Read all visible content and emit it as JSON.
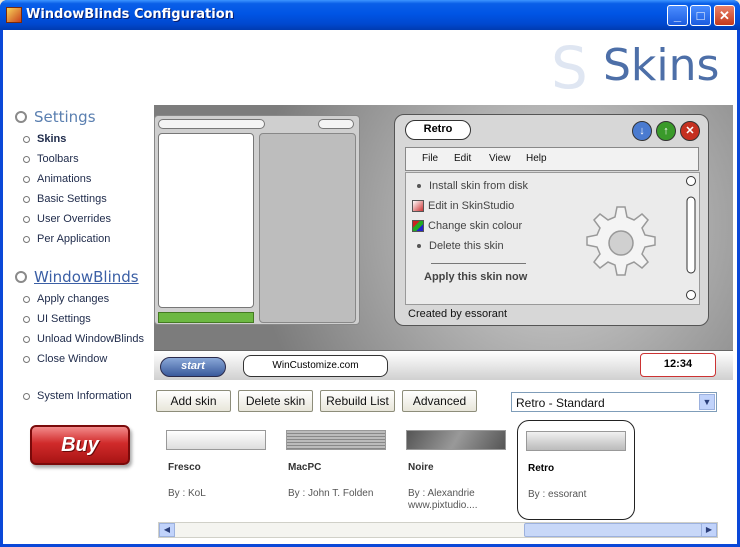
{
  "window": {
    "title": "WindowBlinds Configuration"
  },
  "header": {
    "title": "Skins"
  },
  "nav": {
    "settings_heading": "Settings",
    "settings_items": [
      "Skins",
      "Toolbars",
      "Animations",
      "Basic Settings",
      "User Overrides",
      "Per Application"
    ],
    "wb_heading": "WindowBlinds",
    "wb_items": [
      "Apply changes",
      "UI Settings",
      "Unload WindowBlinds",
      "Close Window"
    ],
    "system_info": "System Information",
    "buy_label": "Buy"
  },
  "preview": {
    "window_title": "Retro",
    "menu": [
      "File",
      "Edit",
      "View",
      "Help"
    ],
    "tasks": [
      "Install skin from disk",
      "Edit in SkinStudio",
      "Change skin colour",
      "Delete this skin"
    ],
    "apply_label": "Apply this skin now",
    "status": "Created by essorant",
    "start_label": "start",
    "taskbar_item": "WinCustomize.com",
    "clock": "12:34"
  },
  "toolbar": {
    "add_skin": "Add skin",
    "delete_skin": "Delete skin",
    "rebuild_list": "Rebuild List",
    "advanced": "Advanced",
    "scheme_select": "Retro - Standard"
  },
  "skins": [
    {
      "name": "Fresco",
      "by": "By : KoL"
    },
    {
      "name": "MacPC",
      "by": "By : John T. Folden"
    },
    {
      "name": "Noire",
      "by": "By : Alexandrie www.pixtudio...."
    },
    {
      "name": "Retro",
      "by": "By : essorant"
    }
  ],
  "colors": {
    "titlebar": "#0055e5",
    "buy": "#d12b2b",
    "accent": "#4d6fa8"
  }
}
